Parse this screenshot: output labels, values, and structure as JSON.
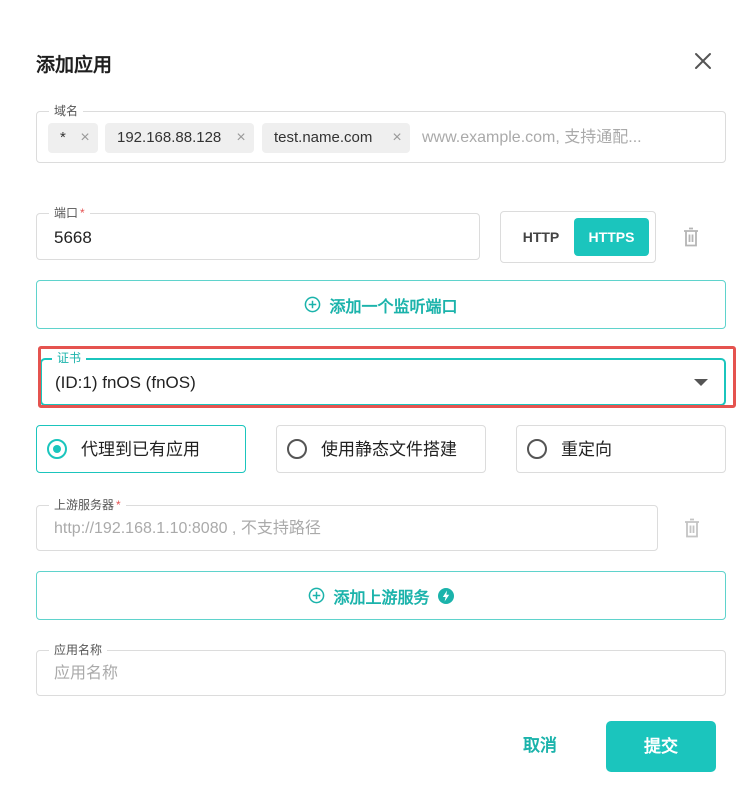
{
  "dialog": {
    "title": "添加应用",
    "close_icon": "close-icon"
  },
  "domain": {
    "label": "域名",
    "chips": [
      "*",
      "192.168.88.128",
      "test.name.com"
    ],
    "placeholder": "www.example.com, 支持通配..."
  },
  "port": {
    "label": "端口",
    "required_mark": "*",
    "value": "5668",
    "protocols": [
      "HTTP",
      "HTTPS"
    ],
    "selected_protocol": "HTTPS",
    "add_label": "添加一个监听端口"
  },
  "certificate": {
    "label": "证书",
    "value": "(ID:1) fnOS (fnOS)"
  },
  "mode": {
    "options": [
      "代理到已有应用",
      "使用静态文件搭建",
      "重定向"
    ],
    "selected": "代理到已有应用"
  },
  "upstream": {
    "label": "上游服务器",
    "required_mark": "*",
    "placeholder": "http://192.168.1.10:8080 , 不支持路径",
    "add_label": "添加上游服务"
  },
  "app_name": {
    "label": "应用名称",
    "placeholder": "应用名称"
  },
  "footer": {
    "cancel": "取消",
    "submit": "提交"
  },
  "colors": {
    "accent": "#1bc5bd",
    "highlight": "#e5534f"
  }
}
